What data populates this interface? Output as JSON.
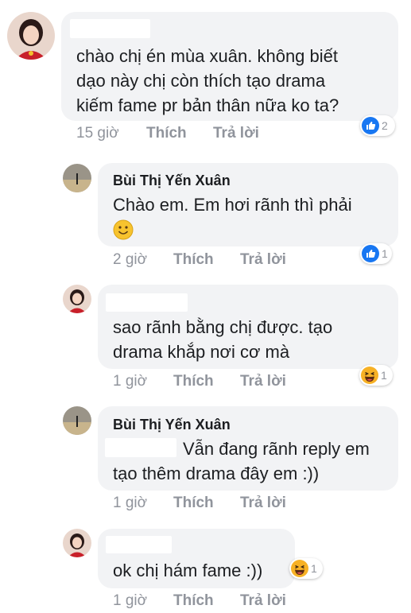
{
  "comments": [
    {
      "text_lines": [
        "chào chị én mùa xuân. không biết",
        "dạo này chị còn thích tạo drama",
        "kiếm fame pr bản thân nữa ko ta?"
      ],
      "time": "15 giờ",
      "like_label": "Thích",
      "reply_label": "Trả lời",
      "reaction": {
        "icon": "like-icon",
        "count": "2"
      }
    },
    {
      "author": "Bùi Thị Yến Xuân",
      "text_lines": [
        "Chào em. Em hơi rãnh thì phải"
      ],
      "time": "2 giờ",
      "like_label": "Thích",
      "reply_label": "Trả lời",
      "reaction": {
        "icon": "like-icon",
        "count": "1"
      }
    },
    {
      "text_lines": [
        "sao rãnh bằng chị được. tạo",
        "drama khắp nơi cơ mà"
      ],
      "time": "1 giờ",
      "like_label": "Thích",
      "reply_label": "Trả lời",
      "reaction": {
        "icon": "haha-icon",
        "count": "1"
      }
    },
    {
      "author": "Bùi Thị Yến Xuân",
      "text_lines": [
        "Vẫn đang rãnh reply em",
        "tạo thêm drama đây em :))"
      ],
      "time": "1 giờ",
      "like_label": "Thích",
      "reply_label": "Trả lời"
    },
    {
      "text_lines": [
        "ok chị hám fame :))"
      ],
      "time": "1 giờ",
      "like_label": "Thích",
      "reply_label": "Trả lời",
      "reaction": {
        "icon": "haha-icon",
        "count": "1"
      }
    }
  ],
  "colors": {
    "bubble": "#f2f3f5",
    "like_blue": "#1877f2",
    "haha_yellow": "#f7b125",
    "meta_gray": "#90949c"
  }
}
